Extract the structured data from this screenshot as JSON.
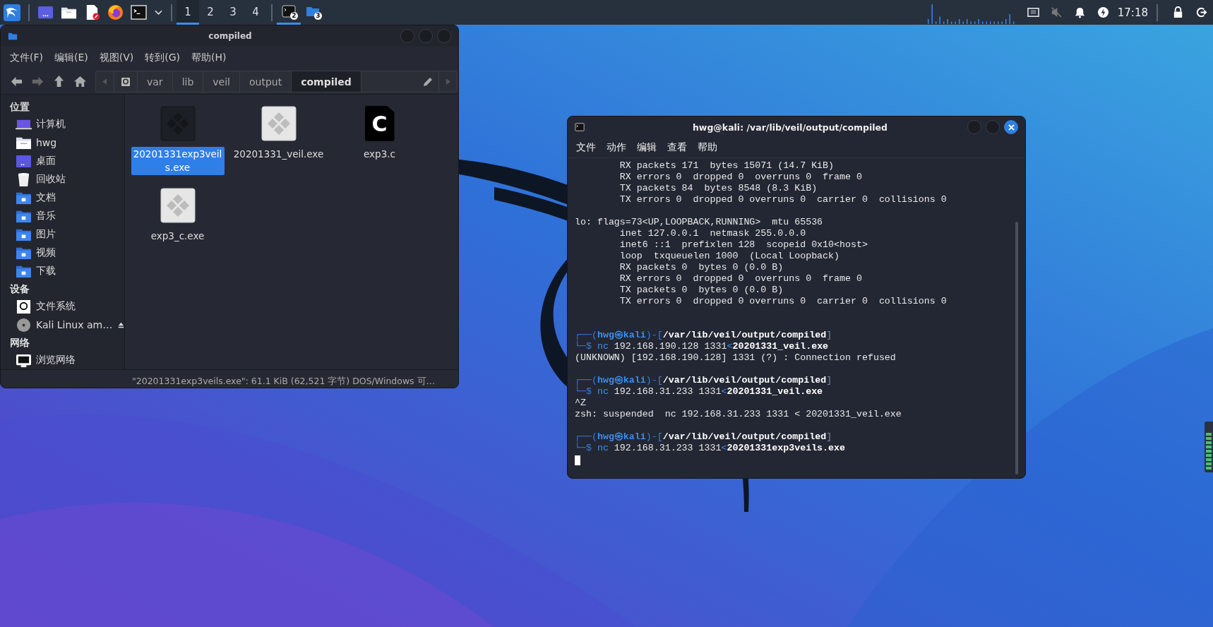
{
  "top_panel": {
    "workspaces": [
      {
        "label": "1",
        "selected": true
      },
      {
        "label": "2",
        "selected": false
      },
      {
        "label": "3",
        "selected": false
      },
      {
        "label": "4",
        "selected": false
      }
    ],
    "tasks": [
      {
        "kind": "terminal",
        "badge": "2",
        "selected": true
      },
      {
        "kind": "folder",
        "badge": "3",
        "selected": false
      }
    ],
    "clock": "17:18"
  },
  "file_manager": {
    "title": "compiled",
    "menu": [
      "文件(F)",
      "编辑(E)",
      "视图(V)",
      "转到(G)",
      "帮助(H)"
    ],
    "path": [
      {
        "label": "var",
        "selected": false
      },
      {
        "label": "lib",
        "selected": false
      },
      {
        "label": "veil",
        "selected": false
      },
      {
        "label": "output",
        "selected": false
      },
      {
        "label": "compiled",
        "selected": true
      }
    ],
    "sidebar": [
      {
        "heading": "位置",
        "items": [
          {
            "kind": "computer",
            "label": "计算机"
          },
          {
            "kind": "home",
            "label": "hwg"
          },
          {
            "kind": "desktop",
            "label": "桌面"
          },
          {
            "kind": "trash",
            "label": "回收站"
          },
          {
            "kind": "documents",
            "label": "文档"
          },
          {
            "kind": "music",
            "label": "音乐"
          },
          {
            "kind": "pictures",
            "label": "图片"
          },
          {
            "kind": "videos",
            "label": "视频"
          },
          {
            "kind": "downloads",
            "label": "下载"
          }
        ]
      },
      {
        "heading": "设备",
        "items": [
          {
            "kind": "drive",
            "label": "文件系统"
          },
          {
            "kind": "disc",
            "label": "Kali Linux am…",
            "eject": true
          }
        ]
      },
      {
        "heading": "网络",
        "items": [
          {
            "kind": "network",
            "label": "浏览网络"
          }
        ]
      }
    ],
    "files": [
      {
        "kind": "exe",
        "name": "20201331exp3veils.exe",
        "selected": true
      },
      {
        "kind": "exe",
        "name": "20201331_veil.exe",
        "selected": false
      },
      {
        "kind": "source",
        "name": "exp3.c",
        "letter": "C",
        "selected": false
      },
      {
        "kind": "exe",
        "name": "exp3_c.exe",
        "selected": false
      }
    ],
    "status": "\"20201331exp3veils.exe\": 61.1 KiB (62,521 字节) DOS/Windows 可…"
  },
  "terminal": {
    "title": "hwg@kali: /var/lib/veil/output/compiled",
    "menu": [
      "文件",
      "动作",
      "编辑",
      "查看",
      "帮助"
    ],
    "lines": [
      {
        "kind": "output",
        "indent": true,
        "text": "RX packets 171  bytes 15071 (14.7 KiB)"
      },
      {
        "kind": "output",
        "indent": true,
        "text": "RX errors 0  dropped 0  overruns 0  frame 0"
      },
      {
        "kind": "output",
        "indent": true,
        "text": "TX packets 84  bytes 8548 (8.3 KiB)"
      },
      {
        "kind": "output",
        "indent": true,
        "text": "TX errors 0  dropped 0 overruns 0  carrier 0  collisions 0"
      },
      {
        "kind": "blank"
      },
      {
        "kind": "output",
        "text": "lo: flags=73<UP,LOOPBACK,RUNNING>  mtu 65536"
      },
      {
        "kind": "output",
        "indent": true,
        "text": "inet 127.0.0.1  netmask 255.0.0.0"
      },
      {
        "kind": "output",
        "indent": true,
        "text": "inet6 ::1  prefixlen 128  scopeid 0x10<host>"
      },
      {
        "kind": "output",
        "indent": true,
        "text": "loop  txqueuelen 1000  (Local Loopback)"
      },
      {
        "kind": "output",
        "indent": true,
        "text": "RX packets 0  bytes 0 (0.0 B)"
      },
      {
        "kind": "output",
        "indent": true,
        "text": "RX errors 0  dropped 0  overruns 0  frame 0"
      },
      {
        "kind": "output",
        "indent": true,
        "text": "TX packets 0  bytes 0 (0.0 B)"
      },
      {
        "kind": "output",
        "indent": true,
        "text": "TX errors 0  dropped 0 overruns 0  carrier 0  collisions 0"
      },
      {
        "kind": "blank"
      },
      {
        "kind": "blank"
      },
      {
        "kind": "prompt",
        "segments": [
          {
            "kind": "frame",
            "text": "┌──("
          },
          {
            "kind": "user",
            "text": "hwg㉿kali"
          },
          {
            "kind": "frame",
            "text": ")-["
          },
          {
            "kind": "path",
            "text": "/var/lib/veil/output/compiled"
          },
          {
            "kind": "close",
            "text": "]"
          }
        ]
      },
      {
        "kind": "prompt",
        "segments": [
          {
            "kind": "frame",
            "text": "└─$"
          },
          {
            "kind": "cmd",
            "text": "nc"
          },
          {
            "kind": "arg",
            "text": "192.168.190.128 1331"
          },
          {
            "kind": "op",
            "text": "<"
          },
          {
            "kind": "file",
            "text": "20201331_veil.exe"
          }
        ]
      },
      {
        "kind": "output",
        "text": "(UNKNOWN) [192.168.190.128] 1331 (?) : Connection refused"
      },
      {
        "kind": "blank"
      },
      {
        "kind": "prompt",
        "segments": [
          {
            "kind": "frame",
            "text": "┌──("
          },
          {
            "kind": "user",
            "text": "hwg㉿kali"
          },
          {
            "kind": "frame",
            "text": ")-["
          },
          {
            "kind": "path",
            "text": "/var/lib/veil/output/compiled"
          },
          {
            "kind": "close",
            "text": "]"
          }
        ]
      },
      {
        "kind": "prompt",
        "segments": [
          {
            "kind": "frame",
            "text": "└─$"
          },
          {
            "kind": "cmd",
            "text": "nc"
          },
          {
            "kind": "arg",
            "text": "192.168.31.233 1331"
          },
          {
            "kind": "op",
            "text": "<"
          },
          {
            "kind": "file",
            "text": "20201331_veil.exe"
          }
        ]
      },
      {
        "kind": "output",
        "text": "^Z"
      },
      {
        "kind": "output",
        "text": "zsh: suspended  nc 192.168.31.233 1331 < 20201331_veil.exe"
      },
      {
        "kind": "blank"
      },
      {
        "kind": "prompt",
        "segments": [
          {
            "kind": "frame",
            "text": "┌──("
          },
          {
            "kind": "user",
            "text": "hwg㉿kali"
          },
          {
            "kind": "frame",
            "text": ")-["
          },
          {
            "kind": "path",
            "text": "/var/lib/veil/output/compiled"
          },
          {
            "kind": "close",
            "text": "]"
          }
        ]
      },
      {
        "kind": "prompt",
        "segments": [
          {
            "kind": "frame",
            "text": "└─$"
          },
          {
            "kind": "cmd",
            "text": "nc"
          },
          {
            "kind": "arg",
            "text": "192.168.31.233 1331"
          },
          {
            "kind": "op",
            "text": "<"
          },
          {
            "kind": "file",
            "text": "20201331exp3veils.exe"
          }
        ]
      }
    ]
  }
}
